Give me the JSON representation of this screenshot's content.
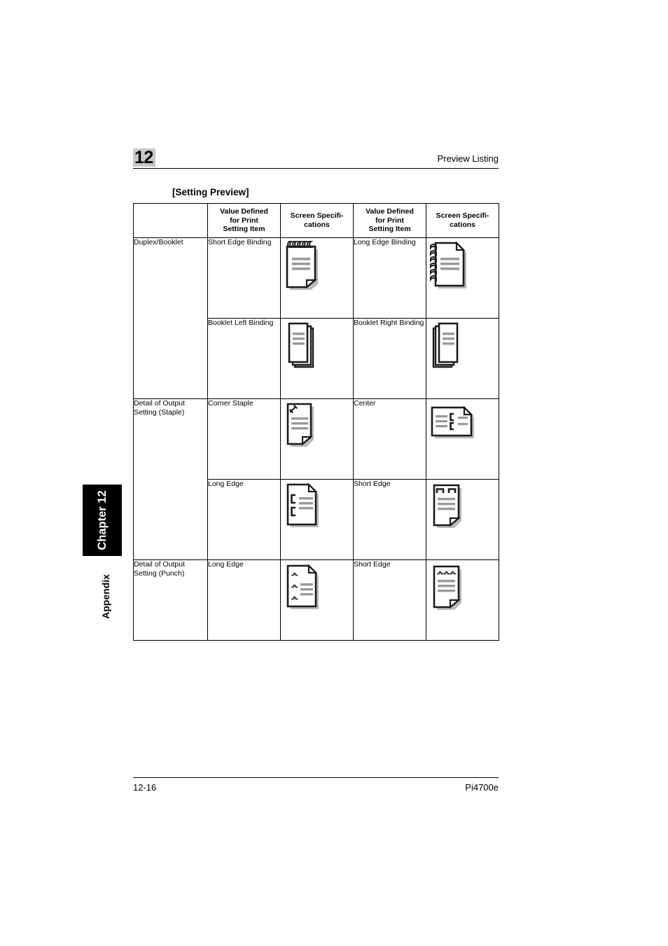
{
  "page": {
    "chapter_number": "12",
    "header_title": "Preview Listing",
    "section_title": "[Setting Preview]",
    "margin_tab_label": "Chapter 12",
    "margin_section_label": "Appendix",
    "footer_page": "12-16",
    "footer_model": "Pi4700e"
  },
  "table": {
    "headers": [
      "",
      "Value Defined for Print Setting Item",
      "Screen Specifi-cations",
      "Value Defined for Print Setting Item",
      "Screen Specifi-cations"
    ],
    "header_lines": {
      "blank": "",
      "value_defined_1": "Value Defined",
      "value_defined_2": "for Print",
      "value_defined_3": "Setting Item",
      "screen_spec_1": "Screen Specifi-",
      "screen_spec_2": "cations"
    },
    "rows": [
      {
        "category": "Duplex/Booklet",
        "category_rowspan": 2,
        "left_value": "Short Edge Binding",
        "left_icon": "page-spiral-top-icon",
        "right_value": "Long Edge Binding",
        "right_icon": "page-spiral-left-icon"
      },
      {
        "category": "",
        "left_value": "Booklet Left Binding",
        "left_icon": "booklet-left-binding-icon",
        "right_value": "Booklet Right Binding",
        "right_icon": "booklet-right-binding-icon"
      },
      {
        "category": "Detail of Output Setting (Staple)",
        "category_rowspan": 2,
        "left_value": "Corner Staple",
        "left_icon": "corner-staple-icon",
        "right_value": "Center",
        "right_icon": "center-staple-icon"
      },
      {
        "category": "",
        "left_value": "Long Edge",
        "left_icon": "long-edge-staple-icon",
        "right_value": "Short Edge",
        "right_icon": "short-edge-staple-icon"
      },
      {
        "category": "Detail of Output Setting (Punch)",
        "category_rowspan": 1,
        "left_value": "Long Edge",
        "left_icon": "long-edge-punch-icon",
        "right_value": "Short Edge",
        "right_icon": "short-edge-punch-icon"
      }
    ],
    "category_lines": {
      "duplex": "Duplex/Booklet",
      "staple_1": "Detail of Output",
      "staple_2": "Setting (Staple)",
      "punch_1": "Detail of Output",
      "punch_2": "Setting (Punch)"
    },
    "values": {
      "short_edge_binding": "Short Edge Binding",
      "long_edge_binding": "Long Edge Binding",
      "booklet_left_binding": "Booklet Left Binding",
      "booklet_right_binding": "Booklet Right Binding",
      "corner_staple": "Corner Staple",
      "center": "Center",
      "long_edge": "Long Edge",
      "short_edge": "Short Edge"
    }
  },
  "colors": {
    "chapter_badge_bg": "#c8c8c8",
    "tab_bg": "#000000",
    "text": "#000000",
    "icon_line": "#999999",
    "icon_shadow": "#b5b5b5"
  }
}
